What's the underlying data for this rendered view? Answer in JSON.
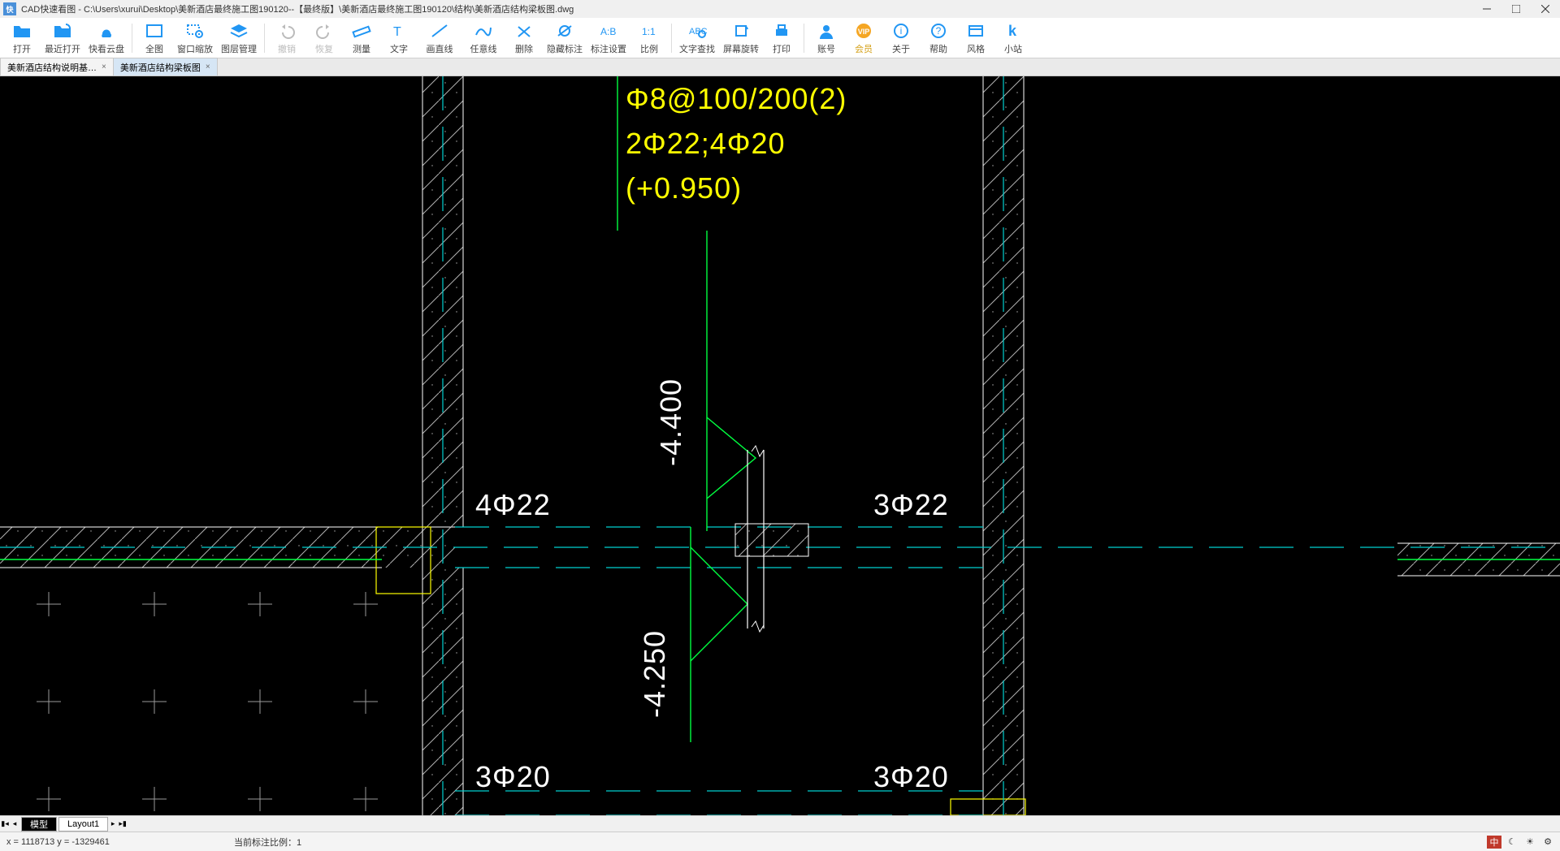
{
  "titlebar": {
    "app_icon_text": "快",
    "title": "CAD快速看图 - C:\\Users\\xurui\\Desktop\\美新酒店最终施工图190120--【最终版】\\美新酒店最终施工图190120\\结构\\美新酒店结构梁板图.dwg"
  },
  "toolbar": [
    {
      "id": "open",
      "label": "打开",
      "color": "#1e88e5"
    },
    {
      "id": "recent",
      "label": "最近打开",
      "color": "#1e88e5"
    },
    {
      "id": "cloud",
      "label": "快看云盘",
      "color": "#1e88e5"
    },
    {
      "id": "sep"
    },
    {
      "id": "full",
      "label": "全图",
      "color": "#1e88e5"
    },
    {
      "id": "zoomwin",
      "label": "窗口缩放",
      "color": "#1e88e5"
    },
    {
      "id": "layers",
      "label": "图层管理",
      "color": "#1e88e5"
    },
    {
      "id": "sep"
    },
    {
      "id": "undo",
      "label": "撤销",
      "color": "#bbb",
      "disabled": true
    },
    {
      "id": "redo",
      "label": "恢复",
      "color": "#bbb",
      "disabled": true
    },
    {
      "id": "measure",
      "label": "测量",
      "color": "#1e88e5"
    },
    {
      "id": "text",
      "label": "文字",
      "color": "#1e88e5"
    },
    {
      "id": "line",
      "label": "画直线",
      "color": "#1e88e5"
    },
    {
      "id": "freeline",
      "label": "任意线",
      "color": "#1e88e5"
    },
    {
      "id": "delete",
      "label": "删除",
      "color": "#1e88e5"
    },
    {
      "id": "hidemarks",
      "label": "隐藏标注",
      "color": "#1e88e5"
    },
    {
      "id": "marksettings",
      "label": "标注设置",
      "color": "#1e88e5"
    },
    {
      "id": "ratio",
      "label": "比例",
      "color": "#1e88e5"
    },
    {
      "id": "sep"
    },
    {
      "id": "findtext",
      "label": "文字查找",
      "color": "#1e88e5"
    },
    {
      "id": "rotate",
      "label": "屏幕旋转",
      "color": "#1e88e5"
    },
    {
      "id": "print",
      "label": "打印",
      "color": "#1e88e5"
    },
    {
      "id": "sep"
    },
    {
      "id": "account",
      "label": "账号",
      "color": "#1e88e5"
    },
    {
      "id": "vip",
      "label": "会员",
      "color": "#f5a623",
      "vip": true
    },
    {
      "id": "about",
      "label": "关于",
      "color": "#1e88e5"
    },
    {
      "id": "help",
      "label": "帮助",
      "color": "#1e88e5"
    },
    {
      "id": "style",
      "label": "风格",
      "color": "#1e88e5"
    },
    {
      "id": "site",
      "label": "小站",
      "color": "#1e88e5"
    }
  ],
  "tabs": [
    {
      "label": "美新酒店结构说明基…",
      "active": false
    },
    {
      "label": "美新酒店结构梁板图",
      "active": true
    }
  ],
  "layout_tabs": {
    "model": "模型",
    "layout1": "Layout1"
  },
  "status": {
    "coords": "x = 1118713  y = -1329461",
    "scale": "当前标注比例：1",
    "ime": "中"
  },
  "drawing": {
    "beam_spec1": "Φ8@100/200(2)",
    "beam_spec2": "2Φ22;4Φ20",
    "beam_spec3": "(+0.950)",
    "rebar_4_22": "4Φ22",
    "rebar_3_22": "3Φ22",
    "rebar_3_20_left": "3Φ20",
    "rebar_3_20_right": "3Φ20",
    "elev_top": "-4.400",
    "elev_bot": "-4.250"
  }
}
